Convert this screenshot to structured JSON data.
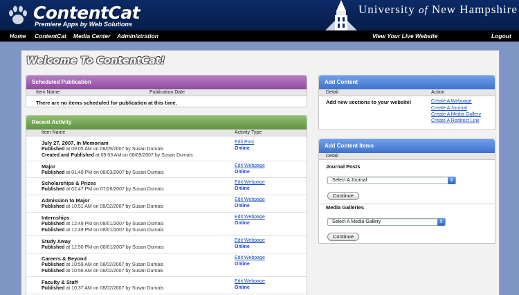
{
  "header": {
    "brand": "ContentCat",
    "tagline": "Premiere Apps by Web Solutions",
    "university_prefix": "University",
    "university_of": "of",
    "university_suffix": "New Hampshire"
  },
  "nav": {
    "home": "Home",
    "contentcat": "ContentCat",
    "media_center": "Media Center",
    "administration": "Administration",
    "view_site": "View Your Live Website",
    "logout": "Logout"
  },
  "page": {
    "title": "Welcome To ContentCat!"
  },
  "scheduled": {
    "title": "Scheduled Publication",
    "col_item": "Item Name",
    "col_date": "Publication Date",
    "empty": "There are no items scheduled for publication at this time."
  },
  "recent": {
    "title": "Recent Activity",
    "col_item": "Item Name",
    "col_type": "Activity Type",
    "rows": [
      {
        "name": "July 27, 2007, In Memoriam",
        "l1_label": "Published",
        "l1_rest": " at 09:05 AM on 08/09/2007 by Susan Dumais",
        "l2_label": "Created and Published",
        "l2_rest": " at 09:03 AM on 08/09/2007 by Susan Dumais",
        "action": "Edit Post",
        "status": "Online"
      },
      {
        "name": "Major",
        "l1_label": "Published",
        "l1_rest": " at 01:40 PM on 08/03/2007 by Susan Dumais",
        "action": "Edit Webpage",
        "status": "Online"
      },
      {
        "name": "Scholarships & Prizes",
        "l1_label": "Published",
        "l1_rest": " at 02:47 PM on 07/26/2007 by Susan Dumais",
        "action": "Edit Webpage",
        "status": "Online"
      },
      {
        "name": "Admission to Major",
        "l1_label": "Published",
        "l1_rest": " at 10:51 AM on 08/02/2007 by Susan Dumais",
        "action": "Edit Webpage",
        "status": "Online"
      },
      {
        "name": "Internships",
        "l1_label": "Published",
        "l1_rest": " at 12:49 PM on 08/01/2007 by Susan Dumais",
        "l2_label": "Published",
        "l2_rest": " at 12:49 PM on 08/01/2007 by Susan Dumais",
        "action": "Edit Webpage",
        "status": "Online"
      },
      {
        "name": "Study Away",
        "l1_label": "Published",
        "l1_rest": " at 12:50 PM on 08/01/2007 by Susan Dumais",
        "action": "Edit Webpage",
        "status": "Online"
      },
      {
        "name": "Careers & Beyond",
        "l1_label": "Published",
        "l1_rest": " at 10:59 AM on 08/02/2007 by Susan Dumais",
        "l2_label": "Published",
        "l2_rest": " at 10:56 AM on 08/02/2007 by Susan Dumais",
        "action": "Edit Webpage",
        "status": "Online"
      },
      {
        "name": "Faculty & Staff",
        "l1_label": "Published",
        "l1_rest": " at 10:37 AM on 08/02/2007 by Susan Dumais",
        "action": "Edit Webpage",
        "status": "Online"
      }
    ]
  },
  "add_content": {
    "title": "Add Content",
    "col_detail": "Detail",
    "col_action": "Action",
    "detail": "Add new sections to your website!",
    "links": [
      "Create A Webpage",
      "Create A Journal",
      "Create A Media Gallery",
      "Create A Redirect Link"
    ]
  },
  "add_items": {
    "title": "Add Content Items",
    "col_detail": "Detail",
    "journal_label": "Journal Posts",
    "journal_select": "Select A Journal",
    "media_label": "Media Galleries",
    "media_select": "Select A Media Gallery",
    "continue": "Continue"
  }
}
